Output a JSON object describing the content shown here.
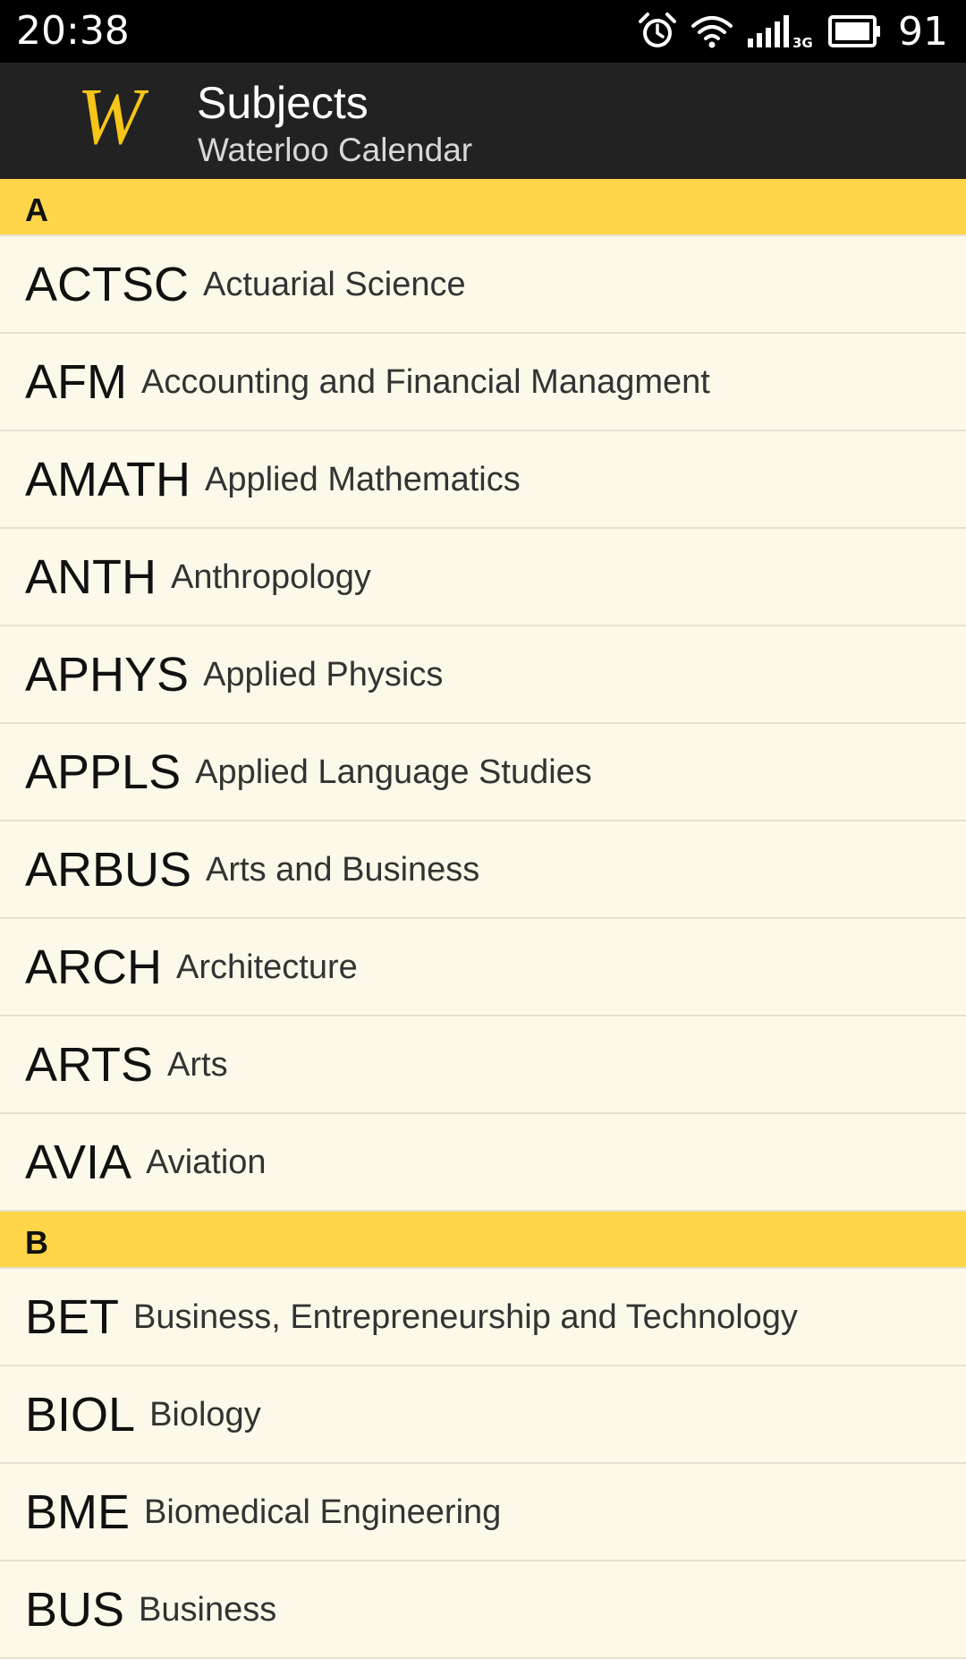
{
  "status_bar": {
    "time": "20:38",
    "battery": "91",
    "network": "3G",
    "icons": [
      "alarm-icon",
      "wifi-icon",
      "cell-signal-icon",
      "battery-icon"
    ]
  },
  "app_bar": {
    "logo": "W",
    "title": "Subjects",
    "subtitle": "Waterloo Calendar",
    "colors": {
      "background": "#222222",
      "logo": "#f5c518"
    }
  },
  "colors": {
    "section_header": "#ffd54a",
    "list_background": "#fdf9ea",
    "divider": "#e6e1cf"
  },
  "sections": [
    {
      "letter": "A",
      "items": [
        {
          "code": "ACTSC",
          "name": "Actuarial Science"
        },
        {
          "code": "AFM",
          "name": "Accounting and Financial Managment"
        },
        {
          "code": "AMATH",
          "name": "Applied Mathematics"
        },
        {
          "code": "ANTH",
          "name": "Anthropology"
        },
        {
          "code": "APHYS",
          "name": "Applied Physics"
        },
        {
          "code": "APPLS",
          "name": "Applied Language Studies"
        },
        {
          "code": "ARBUS",
          "name": "Arts and Business"
        },
        {
          "code": "ARCH",
          "name": "Architecture"
        },
        {
          "code": "ARTS",
          "name": "Arts"
        },
        {
          "code": "AVIA",
          "name": "Aviation"
        }
      ]
    },
    {
      "letter": "B",
      "items": [
        {
          "code": "BET",
          "name": "Business, Entrepreneurship and Technology"
        },
        {
          "code": "BIOL",
          "name": "Biology"
        },
        {
          "code": "BME",
          "name": "Biomedical Engineering"
        },
        {
          "code": "BUS",
          "name": "Business"
        }
      ]
    }
  ]
}
